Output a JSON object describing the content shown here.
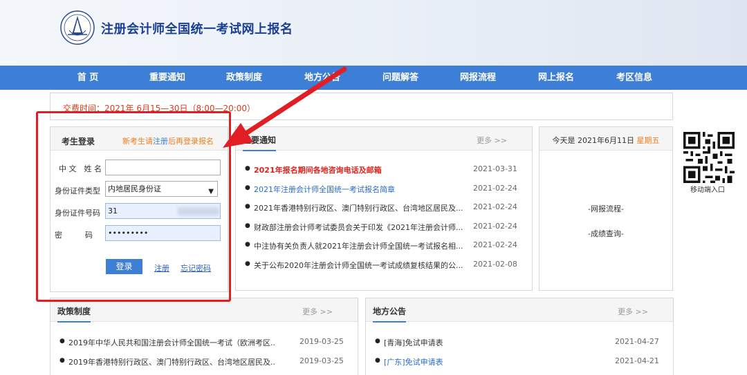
{
  "header": {
    "title": "注册会计师全国统一考试网上报名"
  },
  "nav": [
    "首 页",
    "重要通知",
    "政策制度",
    "地方公告",
    "问题解答",
    "网报流程",
    "网上报名",
    "考区信息"
  ],
  "notice": {
    "text": "交费时间：2021年 6月15—30日（8:00—20:00）"
  },
  "login": {
    "title": "考生登录",
    "hint_prefix": "新考生请",
    "hint_link": "注册",
    "hint_suffix": "后再登录报名",
    "name_label": "中 文　姓 名",
    "name_value": "",
    "idtype_label": "身份证件类型",
    "idtype_value": "内地居民身份证",
    "idnum_label": "身份证件号码",
    "idnum_value": "31",
    "pwd_label": "密　　　码",
    "pwd_value": "•••••••••",
    "login_btn": "登录",
    "register_link": "注册",
    "forgot_link": "忘记密码"
  },
  "important": {
    "title": "重要通知",
    "more": "更多 >>",
    "items": [
      {
        "text": "2021年报名期间各地咨询电话及邮箱",
        "date": "2021-03-31",
        "style": "red"
      },
      {
        "text": "2021年注册会计师全国统一考试报名简章",
        "date": "2021-02-24",
        "style": "blue"
      },
      {
        "text": "2021年香港特别行政区、澳门特别行政区、台湾地区居民及...",
        "date": "2021-02-24",
        "style": ""
      },
      {
        "text": "财政部注册会计师考试委员会关于印发《2021年注册会计师...",
        "date": "2021-02-24",
        "style": ""
      },
      {
        "text": "中注协有关负责人就2021年注册会计师全国统一考试报名相...",
        "date": "2021-02-24",
        "style": ""
      },
      {
        "text": "关于公布2020年注册会计师全国统一考试成绩复核结果的公...",
        "date": "2021-02-08",
        "style": ""
      }
    ]
  },
  "today": {
    "prefix": "今天是 2021年6月11日 ",
    "weekday": "星期五"
  },
  "side_links": [
    "-网报流程-",
    "-成绩查询-"
  ],
  "qr": {
    "label": "移动端入口"
  },
  "policy": {
    "title": "政策制度",
    "more": "更多 >>",
    "items": [
      {
        "text": "2019年中华人民共和国注册会计师全国统一考试（欧洲考区...",
        "date": "2019-03-25"
      },
      {
        "text": "2019年香港特别行政区、澳门特别行政区、台湾地区居民及...",
        "date": "2019-03-25"
      }
    ]
  },
  "local": {
    "title": "地方公告",
    "more": "更多 >>",
    "items": [
      {
        "text": "[青海]免试申请表",
        "date": "2021-04-27",
        "style": ""
      },
      {
        "text": "[广东]免试申请表",
        "date": "2021-04-21",
        "style": "blue"
      }
    ]
  },
  "colors": {
    "nav": "#3d7fd6",
    "title": "#1b3f93",
    "accent_red": "#e01e24",
    "orange": "#f07d1a"
  }
}
